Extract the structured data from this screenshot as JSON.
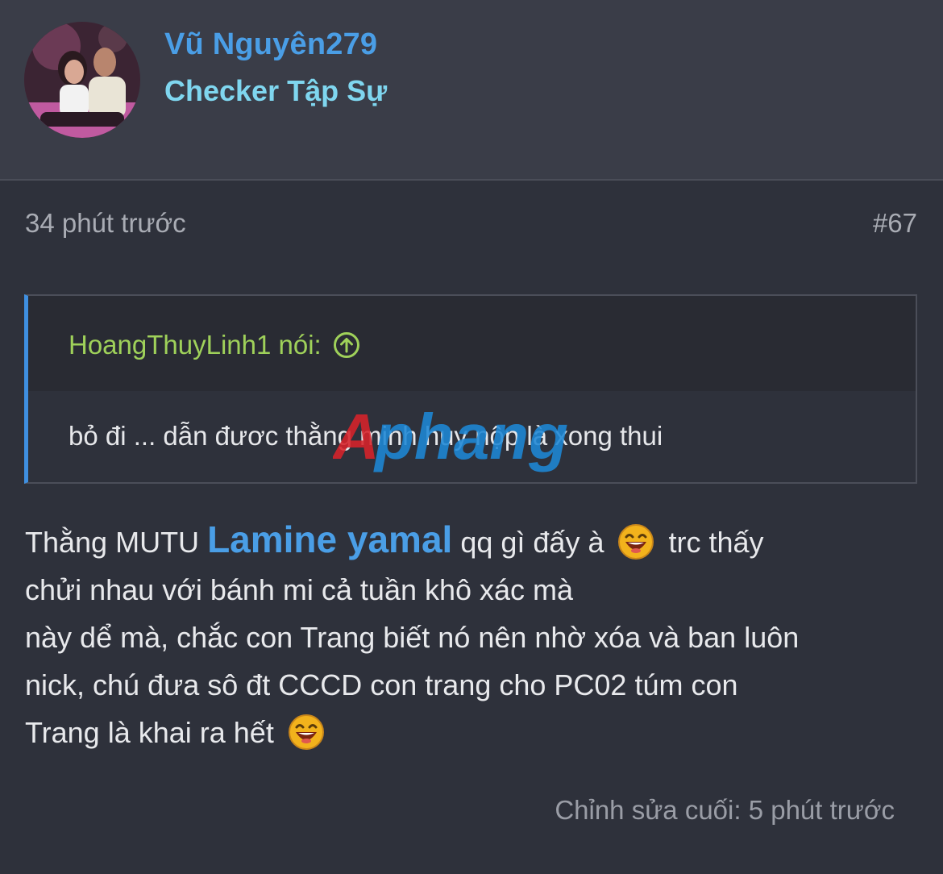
{
  "user": {
    "name": "Vũ Nguyên279",
    "title": "Checker Tập Sự"
  },
  "post": {
    "time": "34 phút trước",
    "number": "#67",
    "edited": "Chỉnh sửa cuối: 5 phút trước"
  },
  "quote": {
    "author": "HoangThuyLinh1 nói:",
    "text": "bỏ đi ... dẫn đươc thằng minh huy nộp là xong thui",
    "watermark": "Aphang"
  },
  "body": {
    "line1_before": "Thằng MUTU ",
    "mention": "Lamine yamal",
    "line1_after": " qq gì đấy à ",
    "line1_tail": " trc thấy",
    "line2": "chửi nhau với bánh mi cả tuần khô xác mà",
    "line3": "này dể mà, chắc con Trang biết nó nên nhờ xóa và ban luôn",
    "line4": "nick, chú đưa sô đt CCCD con trang cho PC02 túm con",
    "line5": "Trang là khai ra hết "
  },
  "icons": {
    "quote_jump": "arrow-up-circle-icon",
    "emoji": "laughing-face-emoji"
  },
  "colors": {
    "username": "#4a9ee6",
    "user_title": "#7fd6ef",
    "quote_author": "#9fd15a",
    "quote_border": "#3f8fe0",
    "background": "#2e313b"
  }
}
